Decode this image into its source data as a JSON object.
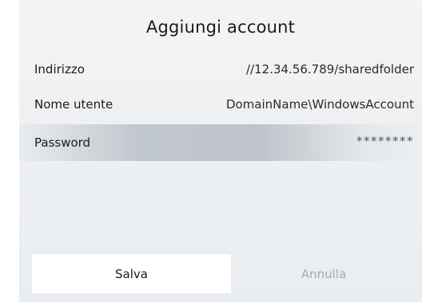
{
  "dialog": {
    "title": "Aggiungi account",
    "fields": [
      {
        "label": "Indirizzo",
        "value": "//12.34.56.789/sharedfolder"
      },
      {
        "label": "Nome utente",
        "value": "DomainName\\WindowsAccount"
      },
      {
        "label": "Password",
        "value": "********"
      }
    ],
    "buttons": {
      "save_label": "Salva",
      "cancel_label": "Annulla"
    }
  }
}
